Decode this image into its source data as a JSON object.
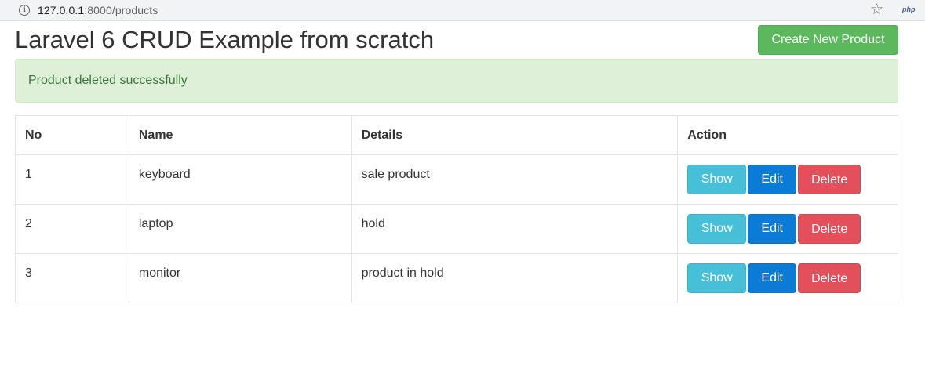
{
  "browser": {
    "url_host": "127.0.0.1",
    "url_rest": ":8000/products",
    "info_icon": "info-icon",
    "star_icon": "star-icon",
    "extension_label": "php"
  },
  "header": {
    "title": "Laravel 6 CRUD Example from scratch",
    "create_button_label": "Create New Product"
  },
  "alert": {
    "message": "Product deleted successfully"
  },
  "table": {
    "columns": [
      "No",
      "Name",
      "Details",
      "Action"
    ],
    "rows": [
      {
        "no": "1",
        "name": "keyboard",
        "details": "sale product"
      },
      {
        "no": "2",
        "name": "laptop",
        "details": "hold"
      },
      {
        "no": "3",
        "name": "monitor",
        "details": "product in hold"
      }
    ],
    "actions": {
      "show": "Show",
      "edit": "Edit",
      "delete": "Delete"
    }
  },
  "colors": {
    "success": "#5cb85c",
    "info": "#47bfd9",
    "primary": "#0b7bd6",
    "danger": "#e3505c",
    "alert_bg": "#dff0d8",
    "alert_text": "#3c763d"
  }
}
